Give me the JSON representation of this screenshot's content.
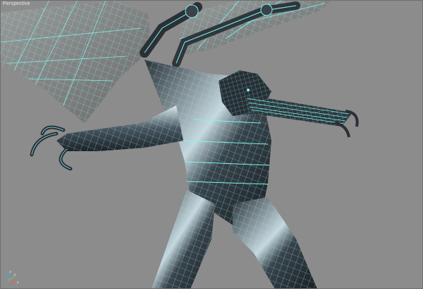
{
  "viewport": {
    "label": "Perspective",
    "background": "#8c8c8c",
    "wire_color": "#7ff5f0",
    "wing_fill": "#7a7a7a",
    "body_dark": "#1c2126",
    "body_light": "#b9c9d2"
  },
  "gizmo": {
    "x_label": "x",
    "y_label": "y",
    "z_label": "z"
  }
}
